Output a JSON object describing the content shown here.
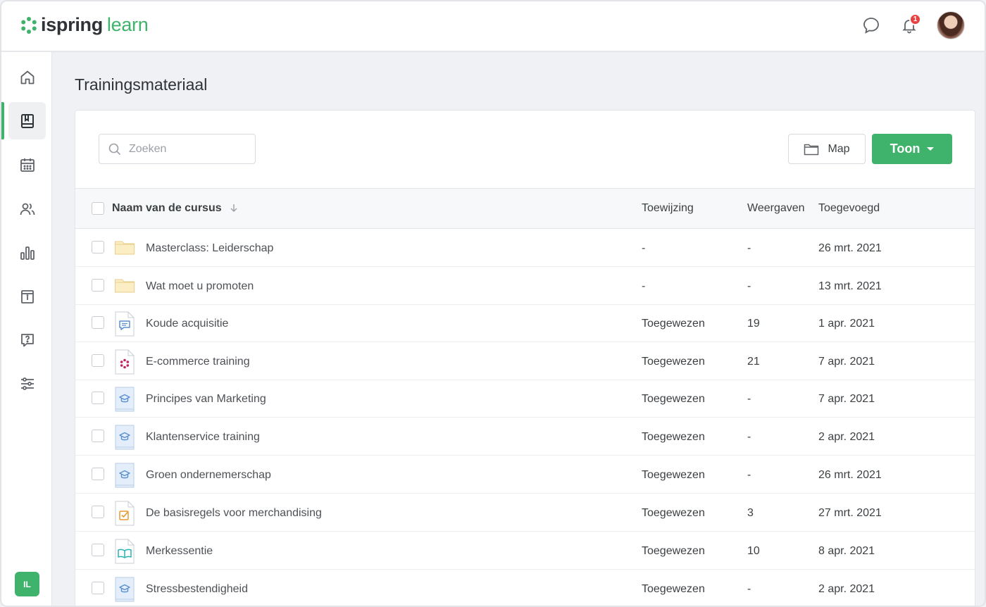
{
  "header": {
    "logo_word1": "ispring",
    "logo_word2": "learn",
    "notification_count": "1",
    "user_initials": "IL"
  },
  "sidebar": {
    "items": [
      {
        "icon": "home-icon"
      },
      {
        "icon": "book-icon",
        "active": true
      },
      {
        "icon": "calendar-icon"
      },
      {
        "icon": "users-icon"
      },
      {
        "icon": "bar-chart-icon"
      },
      {
        "icon": "info-archive-icon"
      },
      {
        "icon": "help-icon"
      },
      {
        "icon": "settings-sliders-icon"
      }
    ]
  },
  "page": {
    "title": "Trainingsmateriaal"
  },
  "toolbar": {
    "search_placeholder": "Zoeken",
    "map_label": "Map",
    "toon_label": "Toon"
  },
  "table": {
    "columns": {
      "name": "Naam van de cursus",
      "assignment": "Toewijzing",
      "views": "Weergaven",
      "added": "Toegevoegd"
    },
    "rows": [
      {
        "icon": "folder-icon",
        "name": "Masterclass: Leiderschap",
        "assignment": "-",
        "views": "-",
        "added": "26 mrt. 2021"
      },
      {
        "icon": "folder-icon",
        "name": "Wat moet u promoten",
        "assignment": "-",
        "views": "-",
        "added": "13 mrt. 2021"
      },
      {
        "icon": "chat-doc-icon",
        "name": "Koude acquisitie",
        "assignment": "Toegewezen",
        "views": "19",
        "added": "1 apr. 2021"
      },
      {
        "icon": "ispring-doc-icon",
        "name": "E-commerce training",
        "assignment": "Toegewezen",
        "views": "21",
        "added": "7 apr. 2021"
      },
      {
        "icon": "course-doc-icon",
        "name": "Principes van Marketing",
        "assignment": "Toegewezen",
        "views": "-",
        "added": "7 apr. 2021"
      },
      {
        "icon": "course-doc-icon",
        "name": "Klantenservice training",
        "assignment": "Toegewezen",
        "views": "-",
        "added": "2 apr. 2021"
      },
      {
        "icon": "course-doc-icon",
        "name": "Groen ondernemerschap",
        "assignment": "Toegewezen",
        "views": "-",
        "added": "26 mrt. 2021"
      },
      {
        "icon": "quiz-doc-icon",
        "name": "De basisregels voor merchandising",
        "assignment": "Toegewezen",
        "views": "3",
        "added": "27 mrt. 2021"
      },
      {
        "icon": "book-doc-icon",
        "name": "Merkessentie",
        "assignment": "Toegewezen",
        "views": "10",
        "added": "8 apr. 2021"
      },
      {
        "icon": "course-doc-icon",
        "name": "Stressbestendigheid",
        "assignment": "Toegewezen",
        "views": "-",
        "added": "2 apr. 2021"
      }
    ]
  },
  "colors": {
    "accent": "#3fb36b",
    "badge": "#e94141"
  }
}
